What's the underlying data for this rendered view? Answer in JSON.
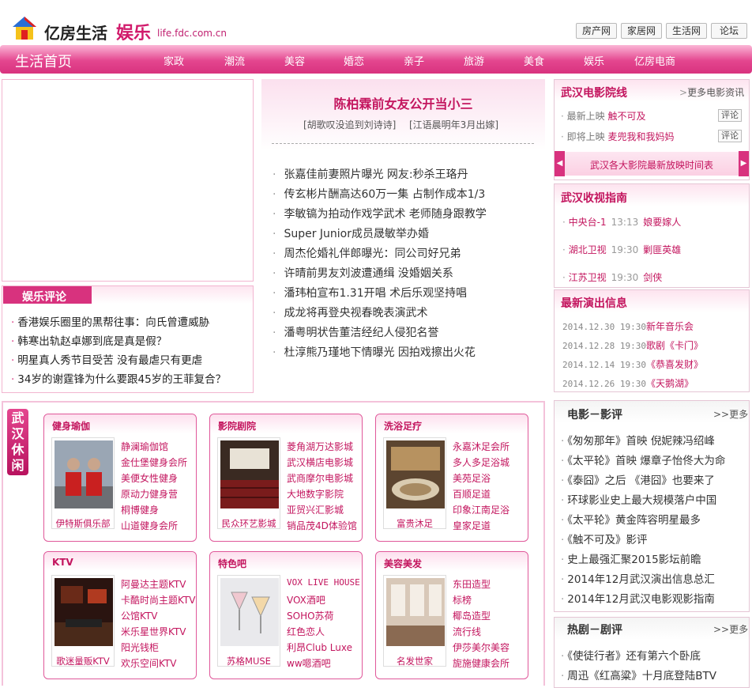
{
  "header": {
    "brand": "亿房生活",
    "brand_ent": "娱乐",
    "url": "life.fdc.com.cn",
    "top_links": [
      "房产网",
      "家居网",
      "生活网",
      "论坛"
    ]
  },
  "nav": {
    "home": "生活首页",
    "items": [
      "家政",
      "潮流",
      "美容",
      "婚恋",
      "亲子",
      "旅游",
      "美食",
      "娱乐",
      "亿房电商"
    ]
  },
  "headline": {
    "title": "陈柏霖前女友公开当小三",
    "sub1": "[胡歌叹没追到刘诗诗]",
    "sub2": "[江语晨明年3月出嫁]",
    "news": [
      "张嘉佳前妻照片曝光 网友:秒杀王珞丹",
      "传玄彬片酬高达60万一集 占制作成本1/3",
      "李敏镐为拍动作戏学武术 老师随身跟教学",
      "Super Junior成员晟敏举办婚",
      "周杰伦婚礼伴郎曝光：同公司好兄弟",
      "许晴前男友刘波遭通缉 没婚姻关系",
      "潘玮柏宣布1.31开唱 术后乐观坚持唱",
      "成龙将再登央视春晚表演武术",
      "潘粤明状告董洁经纪人侵犯名誉",
      "杜淳熊乃瑾地下情曝光 因拍戏擦出火花"
    ]
  },
  "commentary": {
    "title": "娱乐评论",
    "items": [
      "香港娱乐圈里的黑帮往事：向氏曾遭威胁",
      "韩寒出轨赵卓娜到底是真是假？",
      "明星真人秀节目受苦 没有最虐只有更虐",
      "34岁的谢霆锋为什么要跟45岁的王菲复合？"
    ]
  },
  "cinema": {
    "title": "武汉电影院线",
    "more": "更多电影资讯",
    "rows": [
      {
        "label": "最新上映",
        "film": "触不可及",
        "btn": "评论"
      },
      {
        "label": "即将上映",
        "film": "麦兜我和我妈妈",
        "btn": "评论"
      }
    ],
    "schedule": "武汉各大影院最新放映时间表"
  },
  "tv": {
    "title": "武汉收视指南",
    "rows": [
      {
        "channel": "中央台-1",
        "time": "13:13",
        "program": "娘要嫁人"
      },
      {
        "channel": "湖北卫视",
        "time": "19:30",
        "program": "剿匪英雄"
      },
      {
        "channel": "江苏卫视",
        "time": "19:30",
        "program": "剑侠"
      }
    ]
  },
  "shows": {
    "title": "最新演出信息",
    "rows": [
      {
        "date": "2014.12.30 19:30",
        "name": "新年音乐会"
      },
      {
        "date": "2014.12.28 19:30",
        "name": "歌剧《卡门》"
      },
      {
        "date": "2014.12.14 19:30",
        "name": "《恭喜发财》"
      },
      {
        "date": "2014.12.26 19:30",
        "name": "《天鹅湖》"
      }
    ]
  },
  "film_review": {
    "title": "电影－影评",
    "more": ">>更多",
    "items": [
      "《匆匆那年》首映 倪妮辣冯绍峰",
      "《太平轮》首映 爆章子怡佟大为命",
      "《泰囧》之后 《港囧》也要来了",
      "环球影业史上最大规模落户中国",
      "《太平轮》黄金阵容明星最多",
      "《触不可及》影评",
      "史上最强汇聚2015影坛前瞻",
      "2014年12月武汉演出信息总汇",
      "2014年12月武汉电影观影指南"
    ]
  },
  "drama": {
    "title": "热剧－剧评",
    "more": ">>更多",
    "items": [
      "《使徒行者》还有第六个卧底",
      "周迅《红高粱》十月底登陆BTV"
    ]
  },
  "leisure": {
    "tab": "武汉休闲",
    "cards": [
      {
        "title": "健身瑜伽",
        "caption": "伊特斯俱乐部",
        "links": [
          "静澜瑜伽馆",
          "金仕堡健身会所",
          "美便女性健身",
          "原动力健身营",
          "桐博健身",
          "山道健身会所"
        ]
      },
      {
        "title": "影院剧院",
        "caption": "民众环艺影城",
        "links": [
          "菱角湖万达影城",
          "武汉横店电影城",
          "武商摩尔电影城",
          "大地数字影院",
          "亚贸兴汇影城",
          "销品茂4D体验馆"
        ]
      },
      {
        "title": "洗浴足疗",
        "caption": "富贵沐足",
        "links": [
          "永嘉沐足会所",
          "多人多足浴城",
          "美苑足浴",
          "百顺足道",
          "印象江南足浴",
          "皇家足道"
        ]
      },
      {
        "title": "KTV",
        "caption": "歌迷量贩KTV",
        "links": [
          "阿曼达主题KTV",
          "卡酷时尚主题KTV",
          "公馆KTV",
          "米乐星世界KTV",
          "阳光钱柜",
          "欢乐空间KTV"
        ]
      },
      {
        "title": "特色吧",
        "caption": "苏格MUSE",
        "links": [
          "VOX LIVE HOUSE",
          "VOX酒吧",
          "SOHO苏荷",
          "红色恋人",
          "利昂Club Luxe",
          "ww嗯酒吧"
        ]
      },
      {
        "title": "美容美发",
        "caption": "名发世家",
        "links": [
          "东田造型",
          "标榜",
          "椰岛造型",
          "流行线",
          "伊莎美尔美容",
          "旎施健康会所"
        ]
      }
    ]
  }
}
